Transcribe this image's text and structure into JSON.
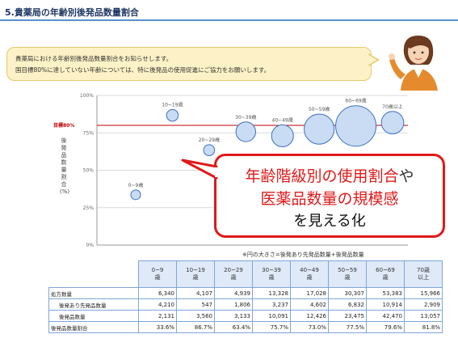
{
  "header": {
    "title": "5.貴薬局の年齢別後発品数量割合"
  },
  "speech": {
    "line1": "貴薬局における年齢別後発品数量割合をお知らせします。",
    "line2": "国目標80%に達していない年齢については、特に後発品の使用促進にご協力をお願いします。"
  },
  "chart_data": {
    "type": "bubble",
    "ylabel": "後発品数量割合(%)",
    "ylim": [
      0,
      100
    ],
    "yticks": [
      "0%",
      "25%",
      "50%",
      "75%",
      "100%"
    ],
    "target": {
      "label": "目標80%",
      "value": 80
    },
    "points": [
      {
        "label": "0~9歳",
        "y": 33.6,
        "size": 2131
      },
      {
        "label": "10~19歳",
        "y": 86.7,
        "size": 3560
      },
      {
        "label": "20~29歳",
        "y": 63.4,
        "size": 3133
      },
      {
        "label": "30~39歳",
        "y": 75.7,
        "size": 10091
      },
      {
        "label": "40~49歳",
        "y": 73.0,
        "size": 12426
      },
      {
        "label": "50~59歳",
        "y": 77.5,
        "size": 23475
      },
      {
        "label": "60~69歳",
        "y": 79.6,
        "size": 42470
      },
      {
        "label": "70歳以上",
        "y": 81.8,
        "size": 13057
      }
    ],
    "note": "※円の大きさ=後発あり先発品数量+後発品数量"
  },
  "callout": {
    "line1_red": "年齢階級別の使用割合",
    "line1_black": "や",
    "line2": "医薬品数量の規模感",
    "line3": "を見える化"
  },
  "table": {
    "headers": [
      {
        "l1": "0~9",
        "l2": "歳"
      },
      {
        "l1": "10~19",
        "l2": "歳"
      },
      {
        "l1": "20~29",
        "l2": "歳"
      },
      {
        "l1": "30~39",
        "l2": "歳"
      },
      {
        "l1": "40~49",
        "l2": "歳"
      },
      {
        "l1": "50~59",
        "l2": "歳"
      },
      {
        "l1": "60~69",
        "l2": "歳"
      },
      {
        "l1": "70歳",
        "l2": "以上"
      }
    ],
    "rows": [
      {
        "label": "処方数量",
        "values": [
          "6,340",
          "4,107",
          "4,939",
          "13,328",
          "17,028",
          "30,307",
          "53,383",
          "15,966"
        ]
      },
      {
        "label": "後発あり先発品数量",
        "values": [
          "4,210",
          "547",
          "1,806",
          "3,237",
          "4,602",
          "6,832",
          "10,914",
          "2,909"
        ]
      },
      {
        "label": "後発品数量",
        "values": [
          "2,131",
          "3,560",
          "3,133",
          "10,091",
          "12,426",
          "23,475",
          "42,470",
          "13,057"
        ]
      },
      {
        "label": "後発品数量割合",
        "values": [
          "33.6%",
          "86.7%",
          "63.4%",
          "75.7%",
          "73.0%",
          "77.5%",
          "79.6%",
          "81.8%"
        ]
      }
    ]
  }
}
